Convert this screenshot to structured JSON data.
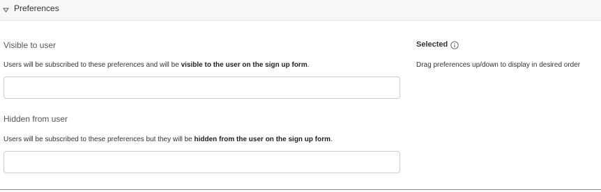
{
  "header": {
    "title": "Preferences"
  },
  "visible": {
    "label": "Visible to user",
    "desc_prefix": "Users will be subscribed to these preferences and will be ",
    "desc_bold": "visible to the user on the sign up form",
    "desc_suffix": ".",
    "field_value": ""
  },
  "hidden": {
    "label": "Hidden from user",
    "desc_prefix": "Users will be subscribed to these preferences but they will be ",
    "desc_bold": "hidden from the user on the sign up form",
    "desc_suffix": ".",
    "field_value": ""
  },
  "selected": {
    "title": "Selected",
    "info_icon": "info-circle-icon",
    "hint": "Drag preferences up/down to display in desired order"
  },
  "colors": {
    "header_bg": "#f7f7f7",
    "border": "#cccccc",
    "text": "#333333"
  }
}
